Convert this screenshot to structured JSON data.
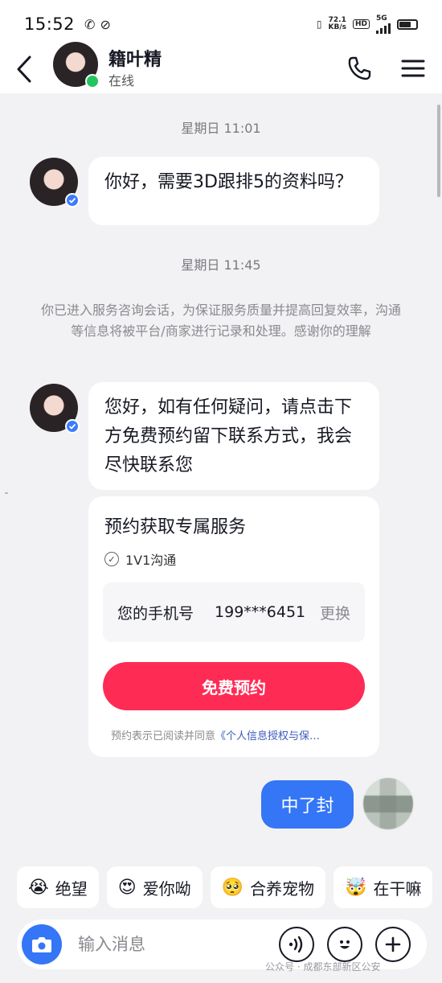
{
  "status_bar": {
    "time": "15:52",
    "net_speed_value": "72.1",
    "net_speed_unit": "KB/s",
    "hd": "HD",
    "network": "5G"
  },
  "header": {
    "contact_name": "籍叶精",
    "contact_status": "在线"
  },
  "messages": {
    "timestamp_1": "星期日 11:01",
    "msg_1": "你好，需要3D跟排5的资料吗？",
    "timestamp_2": "星期日 11:45",
    "system_notice": "你已进入服务咨询会话，为保证服务质量并提高回复效率，沟通等信息将被平台/商家进行记录和处理。感谢你的理解",
    "msg_2": "您好，如有任何疑问，请点击下方免费预约留下联系方式，我会尽快联系您",
    "outgoing_msg": "中了封"
  },
  "reservation_card": {
    "title": "预约获取专属服务",
    "check_item": "1V1沟通",
    "phone_label": "您的手机号",
    "phone_number": "199***6451",
    "change_label": "更换",
    "button_label": "免费预约",
    "agree_text": "预约表示已阅读并同意",
    "agree_link": "《个人信息授权与保…"
  },
  "quick_replies": [
    {
      "emoji": "😭",
      "label": "绝望"
    },
    {
      "emoji": "😍",
      "label": "爱你呦"
    },
    {
      "emoji": "🥺",
      "label": "合养宠物"
    },
    {
      "emoji": "🤯",
      "label": "在干嘛"
    }
  ],
  "input": {
    "placeholder": "输入消息"
  },
  "watermark": "公众号 · 成都东部新区公安",
  "colors": {
    "accent_red": "#fe2c55",
    "outgoing_blue": "#3476f6",
    "online_green": "#22c55e"
  }
}
